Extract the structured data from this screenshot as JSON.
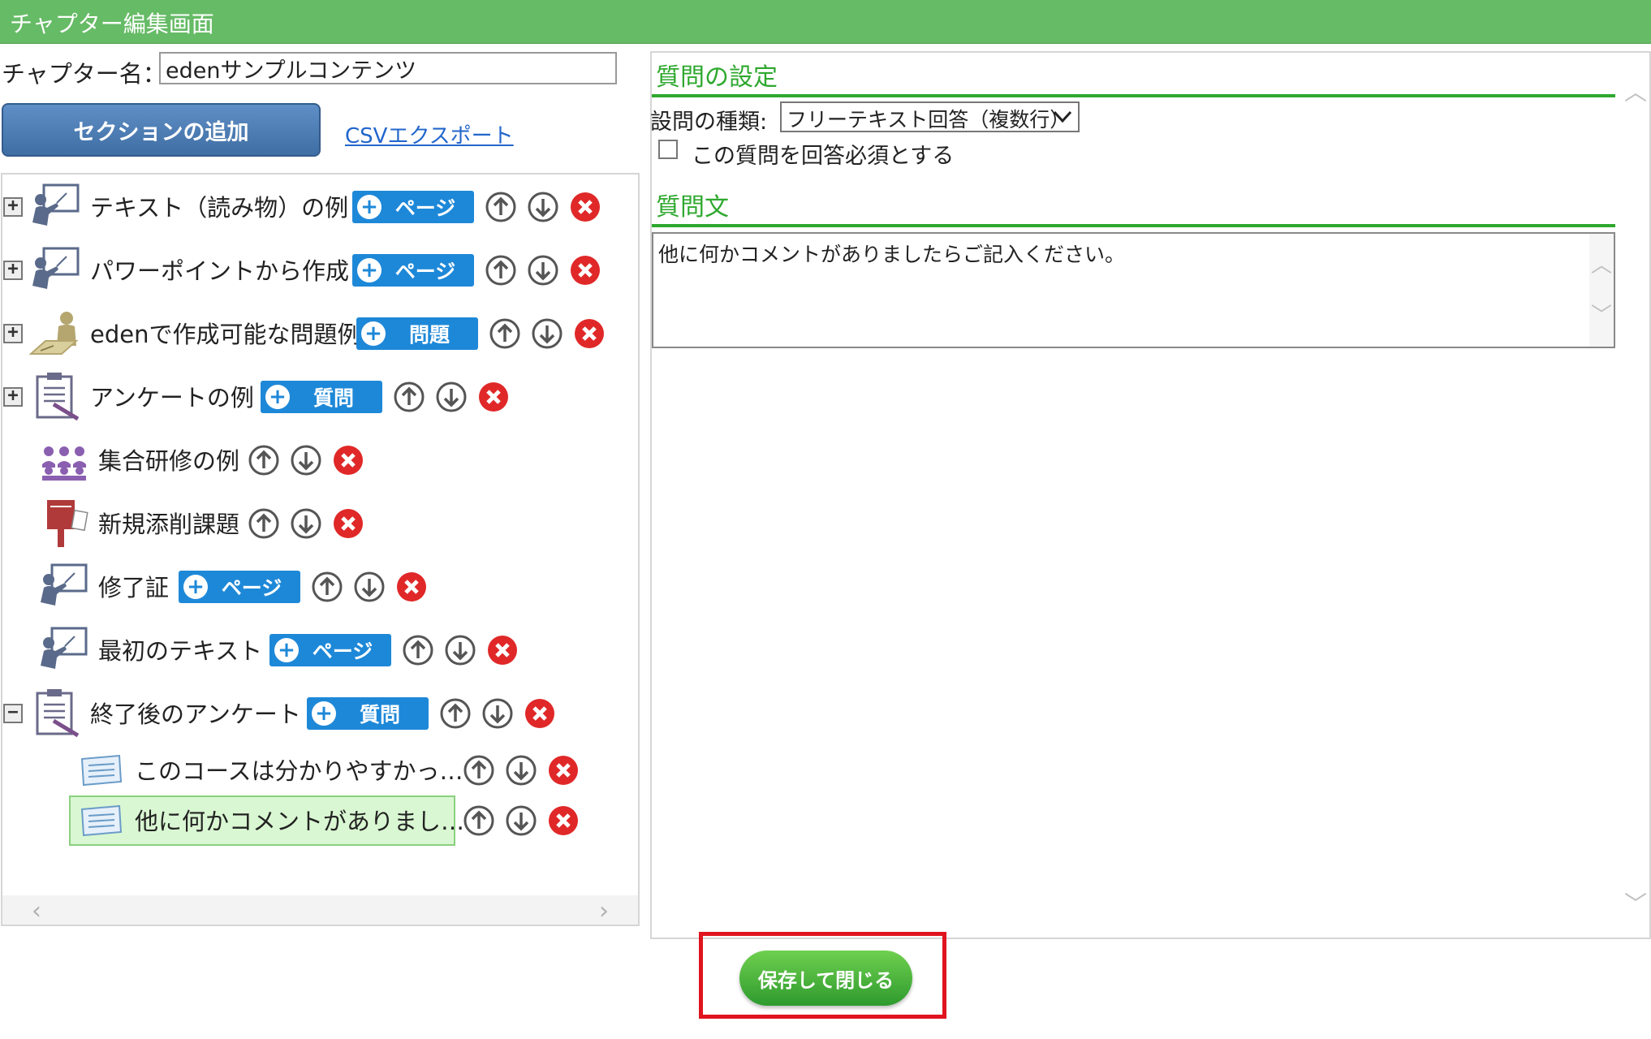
{
  "window": {
    "title": "チャプター編集画面"
  },
  "chapter": {
    "name_label": "チャプター名：",
    "name_value": "edenサンプルコンテンツ"
  },
  "toolbar": {
    "add_section_label": "セクションの追加",
    "csv_export_label": "CSVエクスポート"
  },
  "tree": {
    "items": [
      {
        "label": "テキスト（読み物）の例",
        "button": "ページ",
        "expander": "+"
      },
      {
        "label": "パワーポイントから作成",
        "button": "ページ",
        "expander": "+"
      },
      {
        "label": "edenで作成可能な問題例",
        "button": "問題",
        "expander": "+"
      },
      {
        "label": "アンケートの例",
        "button": "質問",
        "expander": "+"
      },
      {
        "label": "集合研修の例"
      },
      {
        "label": "新規添削課題"
      },
      {
        "label": "修了証",
        "button": "ページ"
      },
      {
        "label": "最初のテキスト",
        "button": "ページ"
      },
      {
        "label": "終了後のアンケート",
        "button": "質問",
        "expander": "−"
      },
      {
        "label": "このコースは分かりやすかっ…"
      },
      {
        "label": "他に何かコメントがありまし…",
        "selected": true
      }
    ],
    "icon_names": [
      "lecture-icon",
      "lecture-icon",
      "exam-icon",
      "survey-icon",
      "group-training-icon",
      "postbox-icon",
      "lecture-icon",
      "lecture-icon",
      "survey-icon",
      "question-card-icon",
      "question-card-icon"
    ]
  },
  "settings": {
    "section_title": "質問の設定",
    "question_type_label": "設問の種類:",
    "question_type_value": "フリーテキスト回答（複数行）",
    "required_label": "この質問を回答必須とする",
    "required_checked": false,
    "question_text_title": "質問文",
    "question_text_value": "他に何かコメントがありましたらご記入ください。"
  },
  "footer": {
    "save_close_label": "保存して閉じる"
  },
  "colors": {
    "titlebar": "#66bb66",
    "accent_green": "#2ea82e",
    "add_button_blue": "#1e88d8",
    "highlight_red": "#e0141e"
  }
}
